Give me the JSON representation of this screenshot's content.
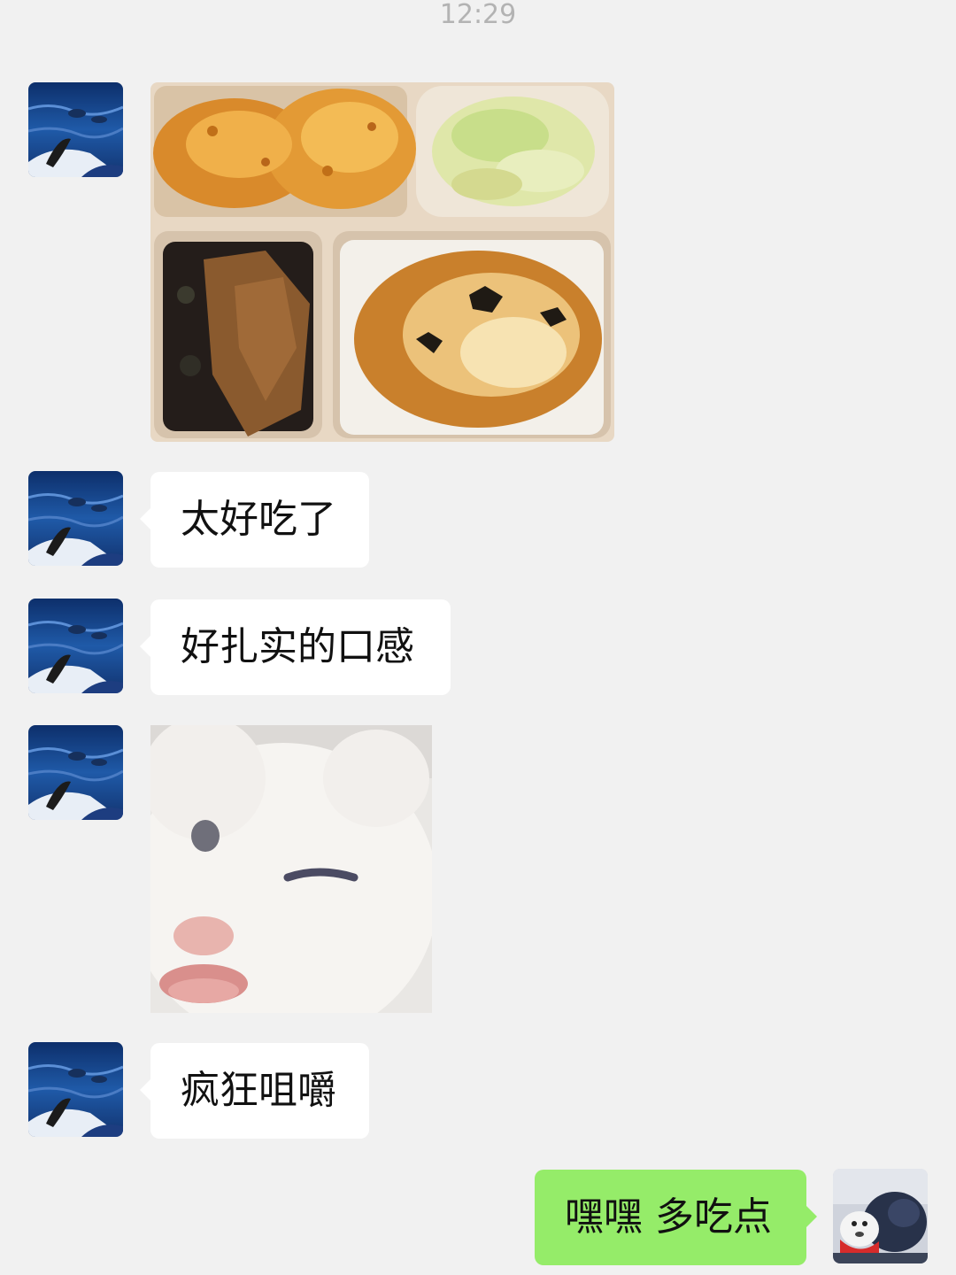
{
  "chat": {
    "timestamp": "12:29",
    "messages": [
      {
        "from": "contact",
        "type": "image",
        "image": "food-bento-box-photo"
      },
      {
        "from": "contact",
        "type": "text",
        "text": "太好吃了"
      },
      {
        "from": "contact",
        "type": "text",
        "text": "好扎实的口感"
      },
      {
        "from": "contact",
        "type": "image",
        "image": "winking-white-cat-sticker"
      },
      {
        "from": "contact",
        "type": "text",
        "text": "疯狂咀嚼"
      },
      {
        "from": "me",
        "type": "text",
        "text": "嘿嘿 多吃点"
      }
    ]
  },
  "colors": {
    "background": "#f1f1f1",
    "incoming_bubble": "#ffffff",
    "outgoing_bubble": "#95ec69",
    "timestamp_text": "#b3b3b3"
  }
}
